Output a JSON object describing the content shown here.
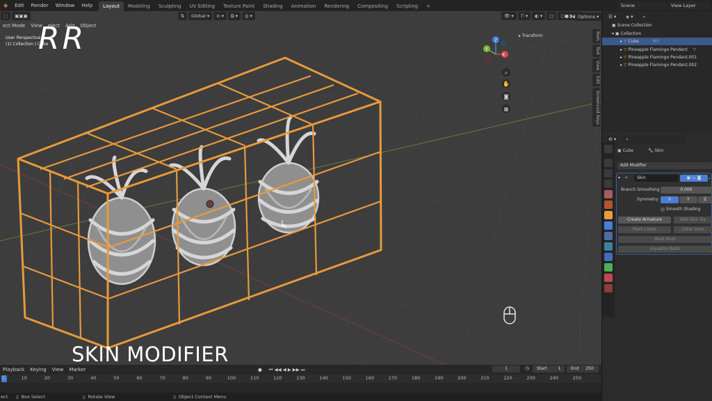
{
  "topbar": {
    "menus": [
      "Edit",
      "Render",
      "Window",
      "Help"
    ],
    "workspaces": [
      "Layout",
      "Modeling",
      "Sculpting",
      "UV Editing",
      "Texture Paint",
      "Shading",
      "Animation",
      "Rendering",
      "Compositing",
      "Scripting"
    ],
    "active_workspace": "Layout",
    "scene": "Scene",
    "view_layer": "View Layer"
  },
  "viewport": {
    "mode": "ect Mode",
    "menus": [
      "View",
      "elect",
      "Add",
      "Object"
    ],
    "transform_orientation": "Global",
    "options_label": "Options",
    "info_line1": "User Perspective",
    "info_line2": "(1) Collection | Cube",
    "logo_text": "RR",
    "n_panel_transform": "Transform",
    "side_tabs": [
      "Item",
      "Tool",
      "View",
      "Edit",
      "Screencast Keys"
    ],
    "gizmo": {
      "x": "X",
      "y": "Y",
      "z": "Z"
    }
  },
  "caption": "SKIN MODIFIER",
  "timeline": {
    "menus": [
      "Playback",
      "Keying",
      "View",
      "Marker"
    ],
    "current_frame": "1",
    "start_label": "Start",
    "start": "1",
    "end_label": "End",
    "end": "250",
    "ticks": [
      "1",
      "10",
      "20",
      "30",
      "40",
      "50",
      "60",
      "70",
      "80",
      "90",
      "100",
      "110",
      "120",
      "130",
      "140",
      "150",
      "160",
      "170",
      "180",
      "190",
      "200",
      "210",
      "220",
      "230",
      "240",
      "250"
    ]
  },
  "statusbar": {
    "items": [
      "ect",
      "Box Select",
      "Rotate View",
      "Object Context Menu"
    ]
  },
  "outliner": {
    "root": "Scene Collection",
    "collection": "Collection",
    "items": [
      "Cube",
      "Pineapple Flamingo Pendant",
      "Pineapple Flamingo Pendant.001",
      "Pineapple Flamingo Pendant.002"
    ]
  },
  "properties": {
    "object_name": "Cube",
    "modifier_name_label": "Skin",
    "add_modifier": "Add Modifier",
    "modifier": "Skin",
    "branch_smoothing_label": "Branch Smoothing",
    "branch_smoothing": "0.000",
    "symmetry_label": "Symmetry",
    "symmetry_axes": [
      "X",
      "Y",
      "Z"
    ],
    "smooth_shading": "Smooth Shading",
    "create_armature": "Create Armature",
    "add_skin_data": "Add Skin Da",
    "mark_loose": "Mark Loose",
    "clear_loose": "Clear Loos",
    "mark_root": "Mark Root",
    "equalize_radii": "Equalize Radii"
  },
  "colors": {
    "accent": "#e89a3c",
    "selection": "#3b5a8a",
    "viewport_bg": "#3d3d3d"
  }
}
